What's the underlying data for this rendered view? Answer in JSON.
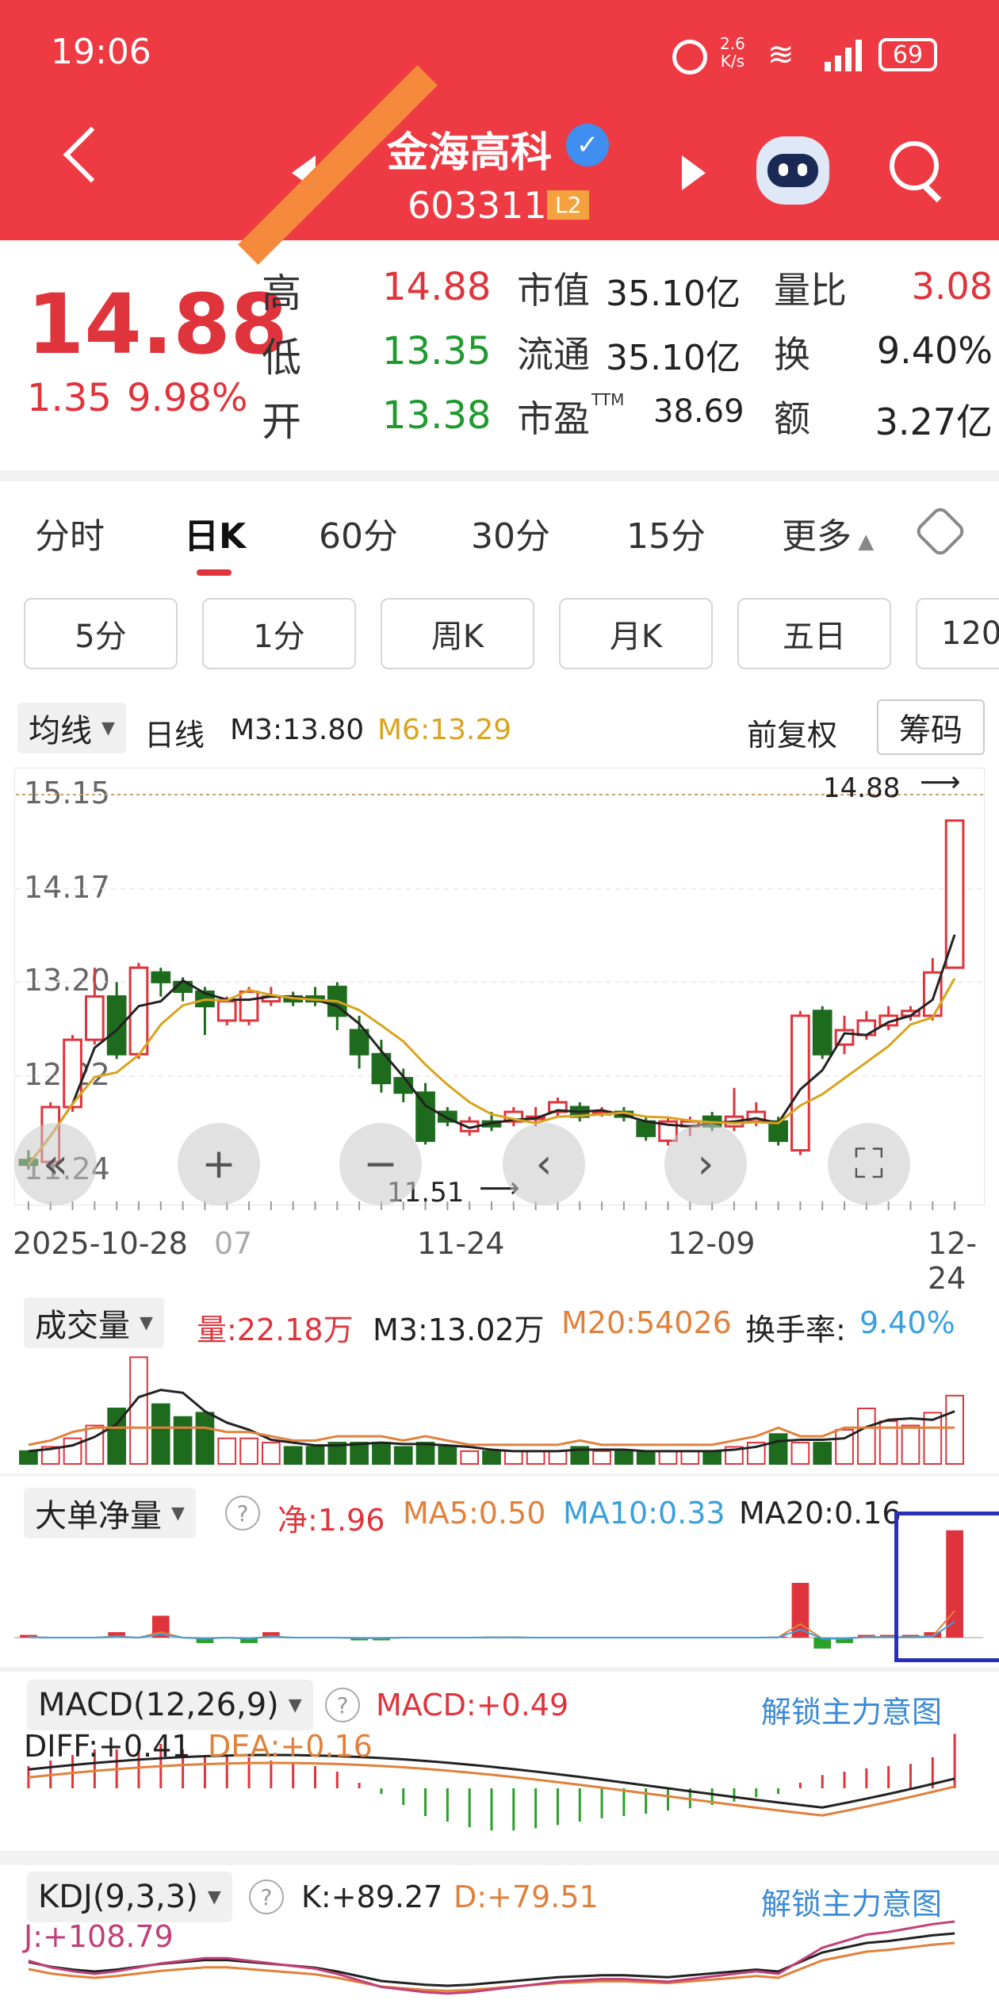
{
  "status_bar": {
    "time": "19:06",
    "net_speed_top": "2.6",
    "net_speed_bottom": "K/s",
    "battery": "69"
  },
  "header": {
    "title": "金海高科",
    "code": "603311",
    "level": "L2"
  },
  "quote": {
    "price": "14.88",
    "change": "1.35",
    "change_pct": "9.98%",
    "rows": [
      {
        "label": "高",
        "value": "14.88",
        "color": "#e0343c",
        "k2": "市值",
        "v2": "35.10亿",
        "k3": "量比",
        "v3": "3.08",
        "c3": "#e0343c"
      },
      {
        "label": "低",
        "value": "13.35",
        "color": "#1e9a2e",
        "k2": "流通",
        "v2": "35.10亿",
        "k3": "换",
        "v3": "9.40%",
        "c3": "#222"
      },
      {
        "label": "开",
        "value": "13.38",
        "color": "#1e9a2e",
        "k2": "市盈",
        "k2_sup": "TTM",
        "v2": "38.69",
        "k3": "额",
        "v3": "3.27亿",
        "c3": "#222"
      }
    ]
  },
  "period_tabs": [
    "分时",
    "日K",
    "60分",
    "30分",
    "15分",
    "更多"
  ],
  "active_tab": "日K",
  "sub_periods": [
    "5分",
    "1分",
    "周K",
    "月K",
    "五日",
    "120"
  ],
  "kline_legend": {
    "selector": "均线",
    "period": "日线",
    "m3": "M3:13.80",
    "m6": "M6:13.29",
    "adjust": "前复权",
    "chip": "筹码"
  },
  "kline": {
    "y_ticks": [
      "15.15",
      "14.17",
      "13.20",
      "12.22",
      "11.24"
    ],
    "x_ticks": [
      "2025-10-28",
      "07",
      "11-24",
      "12-09",
      "12-24"
    ],
    "high_marker": "14.88",
    "low_marker": "11.51"
  },
  "volume_legend": {
    "selector": "成交量",
    "vol": "量:22.18万",
    "m3": "M3:13.02万",
    "m20": "M20:54026",
    "turnover_label": "换手率:",
    "turnover": "9.40%"
  },
  "bigorder_legend": {
    "selector": "大单净量",
    "net": "净:1.96",
    "ma5": "MA5:0.50",
    "ma10": "MA10:0.33",
    "ma20": "MA20:0.16"
  },
  "macd_legend": {
    "selector": "MACD(12,26,9)",
    "macd": "MACD:+0.49",
    "unlock": "解锁主力意图",
    "diff": "DIFF:+0.41",
    "dea": "DEA:+0.16"
  },
  "kdj_legend": {
    "selector": "KDJ(9,3,3)",
    "k": "K:+89.27",
    "d": "D:+79.51",
    "unlock": "解锁主力意图",
    "j": "J:+108.79"
  },
  "chart_data": {
    "type": "candlestick",
    "series": [
      {
        "name": "M3"
      },
      {
        "name": "M6"
      }
    ],
    "candles": [
      [
        11.35,
        11.3,
        11.45,
        11.25
      ],
      [
        11.33,
        11.9,
        11.95,
        11.25
      ],
      [
        11.9,
        12.6,
        12.65,
        11.85
      ],
      [
        12.6,
        13.05,
        13.35,
        12.55
      ],
      [
        13.05,
        12.45,
        13.2,
        12.4
      ],
      [
        12.45,
        13.35,
        13.4,
        12.4
      ],
      [
        13.3,
        13.2,
        13.35,
        13.05
      ],
      [
        13.2,
        13.1,
        13.25,
        13.0
      ],
      [
        13.1,
        12.95,
        13.15,
        12.65
      ],
      [
        12.8,
        13.0,
        13.05,
        12.75
      ],
      [
        12.8,
        13.1,
        13.15,
        12.75
      ],
      [
        13.0,
        13.05,
        13.15,
        12.95
      ],
      [
        13.05,
        13.0,
        13.1,
        12.95
      ],
      [
        13.05,
        13.0,
        13.15,
        12.95
      ],
      [
        13.15,
        12.85,
        13.2,
        12.7
      ],
      [
        12.7,
        12.45,
        12.85,
        12.3
      ],
      [
        12.45,
        12.15,
        12.6,
        12.05
      ],
      [
        12.2,
        12.05,
        12.3,
        11.95
      ],
      [
        12.05,
        11.55,
        12.15,
        11.51
      ],
      [
        11.85,
        11.75,
        11.9,
        11.7
      ],
      [
        11.65,
        11.75,
        11.8,
        11.6
      ],
      [
        11.75,
        11.7,
        11.85,
        11.65
      ],
      [
        11.75,
        11.85,
        11.9,
        11.7
      ],
      [
        11.8,
        11.8,
        11.9,
        11.7
      ],
      [
        11.85,
        11.95,
        12.0,
        11.8
      ],
      [
        11.9,
        11.8,
        11.95,
        11.75
      ],
      [
        11.85,
        11.85,
        11.9,
        11.8
      ],
      [
        11.85,
        11.8,
        11.9,
        11.75
      ],
      [
        11.75,
        11.6,
        11.8,
        11.55
      ],
      [
        11.55,
        11.75,
        11.8,
        11.5
      ],
      [
        11.7,
        11.75,
        11.8,
        11.6
      ],
      [
        11.8,
        11.7,
        11.85,
        11.65
      ],
      [
        11.7,
        11.8,
        12.1,
        11.65
      ],
      [
        11.75,
        11.85,
        11.95,
        11.7
      ],
      [
        11.75,
        11.55,
        11.8,
        11.5
      ],
      [
        11.45,
        12.85,
        12.9,
        11.4
      ],
      [
        12.9,
        12.45,
        12.95,
        12.4
      ],
      [
        12.55,
        12.7,
        12.85,
        12.45
      ],
      [
        12.65,
        12.8,
        12.9,
        12.6
      ],
      [
        12.75,
        12.85,
        12.95,
        12.7
      ],
      [
        12.85,
        12.9,
        12.95,
        12.8
      ],
      [
        12.85,
        13.3,
        13.45,
        12.8
      ],
      [
        13.35,
        14.88,
        14.88,
        13.35
      ]
    ],
    "ylim": [
      11.24,
      15.15
    ]
  }
}
